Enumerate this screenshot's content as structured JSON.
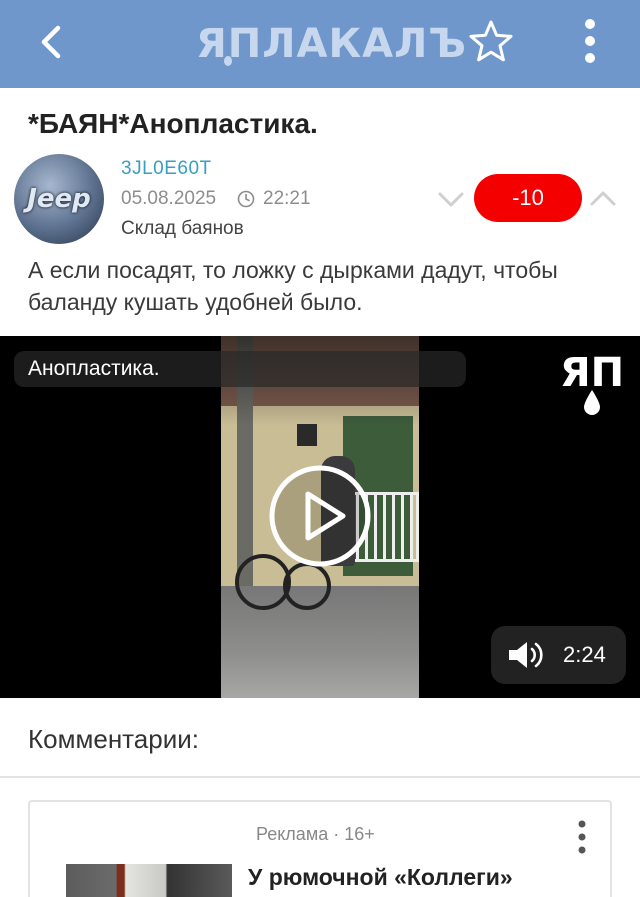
{
  "header": {
    "logo_text": "ЯПЛАКАЛЪ",
    "background_color": "#6f97cc",
    "back_icon": "chevron-left-icon",
    "star_icon": "star-outline-icon",
    "more_icon": "vertical-dots-icon"
  },
  "post": {
    "title": "*БАЯН*Анопластика.",
    "author": {
      "name": "3JL0E60T",
      "avatar_text": "Jeep"
    },
    "date": "05.08.2025",
    "time": "22:21",
    "section": "Склад баянов",
    "rating": "-10",
    "rating_color": "#f40000",
    "text": "А если посадят, то ложку с дырками дадут, чтобы баланду кушать удобней было."
  },
  "video": {
    "title": "Анопластика.",
    "logo_text": "ЯП",
    "duration": "2:24"
  },
  "comments": {
    "heading": "Комментарии:"
  },
  "ad": {
    "label": "Реклама · 16+",
    "title": "У рюмочной «Коллеги»"
  }
}
